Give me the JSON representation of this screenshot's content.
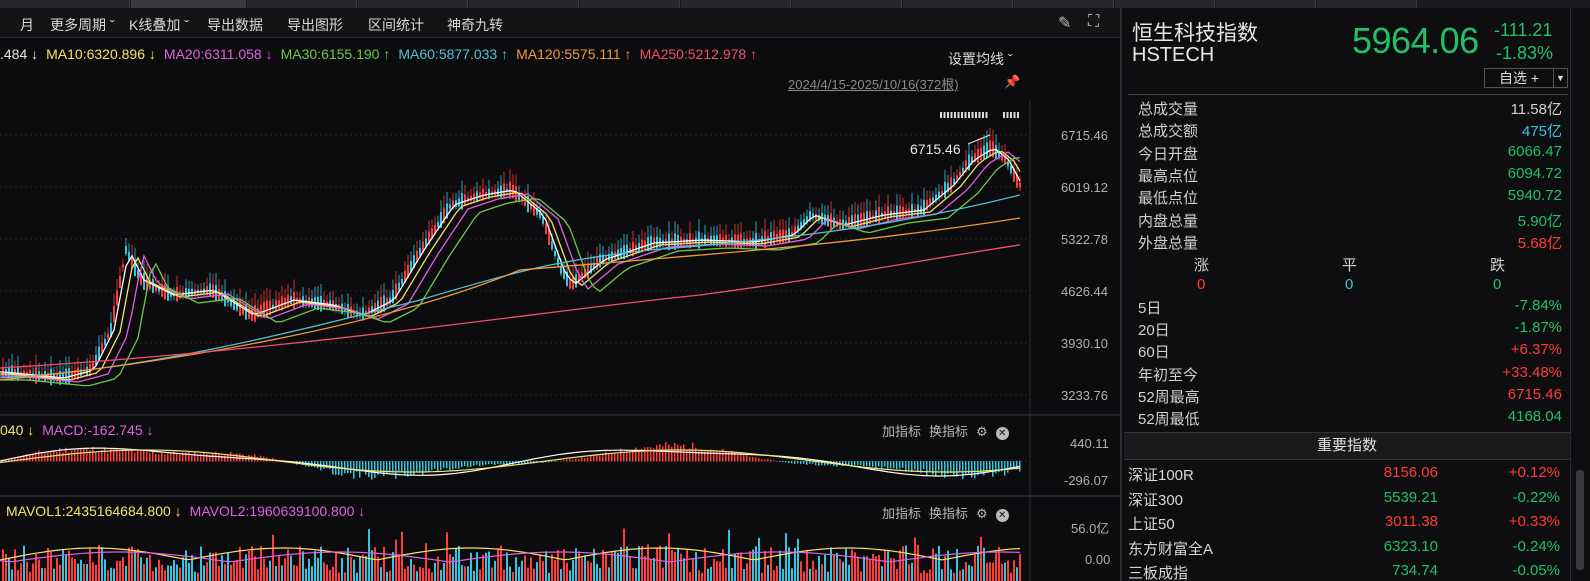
{
  "toolbar": {
    "items": [
      "月",
      "更多周期 ˇ",
      "K线叠加 ˇ",
      "导出数据",
      "导出图形",
      "区间统计",
      "神奇九转"
    ]
  },
  "ma_line": [
    {
      "text": ".484 ↓",
      "color": "#e6e6e6"
    },
    {
      "text": "MA10:6320.896 ↓",
      "color": "#f5e26a"
    },
    {
      "text": "MA20:6311.058 ↓",
      "color": "#e060e0"
    },
    {
      "text": "MA30:6155.190 ↑",
      "color": "#6ac94a"
    },
    {
      "text": "MA60:5877.033 ↑",
      "color": "#4ec3d6"
    },
    {
      "text": "MA120:5575.111 ↑",
      "color": "#f09a3c"
    },
    {
      "text": "MA250:5212.978 ↑",
      "color": "#f0506a"
    }
  ],
  "ma_settings": "设置均线 ˇ",
  "date_range": "2024/4/15-2025/10/16(372根)",
  "price_axis": [
    "6715.46",
    "6019.12",
    "5322.78",
    "4626.44",
    "3930.10",
    "3233.76"
  ],
  "high_marker": "6715.46",
  "macd_header": [
    {
      "text": "040 ↓",
      "color": "#f5e26a"
    },
    {
      "text": "MACD:-162.745 ↓",
      "color": "#e060e0"
    }
  ],
  "macd_axis": [
    "440.11",
    "-296.07"
  ],
  "vol_header": [
    {
      "text": "MAVOL1:2435164684.800 ↓",
      "color": "#f5e26a"
    },
    {
      "text": "MAVOL2:1960639100.800 ↓",
      "color": "#e060e0"
    }
  ],
  "vol_axis": [
    "56.0亿",
    "0.00"
  ],
  "sub_btns": {
    "add": "加指标",
    "switch": "换指标"
  },
  "index": {
    "name": "恒生科技指数",
    "code": "HSTECH",
    "price": "5964.06",
    "change": "-111.21",
    "pct": "-1.83%",
    "watch": "自选 +",
    "watch_drop": "▼"
  },
  "stats": [
    {
      "k": "总成交量",
      "v": "11.58亿",
      "color": "#d0d0d0"
    },
    {
      "k": "总成交额",
      "v": "475亿",
      "color": "#33c6e0"
    },
    {
      "k": "今日开盘",
      "v": "6066.47",
      "color": "#21c06a"
    },
    {
      "k": "最高点位",
      "v": "6094.72",
      "color": "#21c06a"
    },
    {
      "k": "最低点位",
      "v": "5940.72",
      "color": "#21c06a"
    },
    {
      "k": "内盘总量",
      "v": "5.90亿",
      "color": "#21c06a"
    },
    {
      "k": "外盘总量",
      "v": "5.68亿",
      "color": "#ff3b3b"
    }
  ],
  "updown": {
    "labels": [
      "涨",
      "平",
      "跌"
    ],
    "values": [
      "0",
      "0",
      "0"
    ]
  },
  "periods": [
    {
      "k": "5日",
      "v": "-7.84%",
      "color": "#21c06a"
    },
    {
      "k": "20日",
      "v": "-1.87%",
      "color": "#21c06a"
    },
    {
      "k": "60日",
      "v": "+6.37%",
      "color": "#ff3b3b"
    },
    {
      "k": "年初至今",
      "v": "+33.48%",
      "color": "#ff3b3b"
    },
    {
      "k": "52周最高",
      "v": "6715.46",
      "color": "#ff3b3b"
    },
    {
      "k": "52周最低",
      "v": "4168.04",
      "color": "#21c06a"
    }
  ],
  "section_title": "重要指数",
  "indices": [
    {
      "n": "深证100R",
      "p": "8156.06",
      "c": "+0.12%",
      "pc": "#ff3b3b",
      "cc": "#ff3b3b"
    },
    {
      "n": "深证300",
      "p": "5539.21",
      "c": "-0.22%",
      "pc": "#21c06a",
      "cc": "#21c06a"
    },
    {
      "n": "上证50",
      "p": "3011.38",
      "c": "+0.33%",
      "pc": "#ff3b3b",
      "cc": "#ff3b3b"
    },
    {
      "n": "东方财富全A",
      "p": "6323.10",
      "c": "-0.24%",
      "pc": "#21c06a",
      "cc": "#21c06a"
    },
    {
      "n": "三板成指",
      "p": "734.74",
      "c": "-0.05%",
      "pc": "#21c06a",
      "cc": "#21c06a"
    }
  ],
  "colors": {
    "up": "#ff3b3b",
    "down": "#21c06a",
    "flat": "#33c6e0"
  }
}
